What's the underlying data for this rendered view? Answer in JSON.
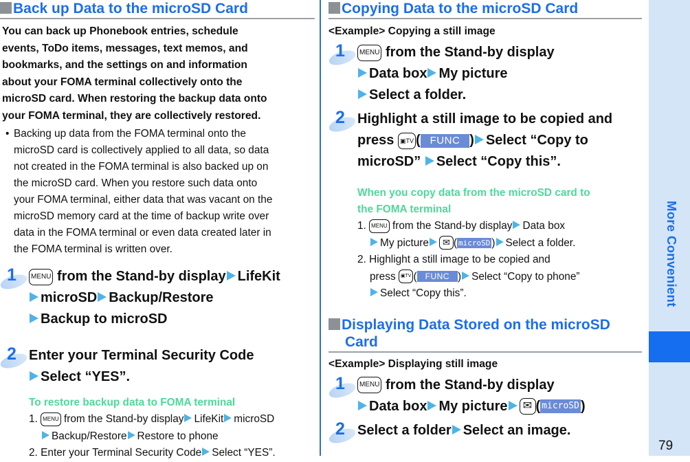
{
  "left": {
    "title": "Back up Data to the microSD Card",
    "intro": "You can back up Phonebook entries, schedule events, ToDo items, messages, text memos, and bookmarks, and the settings on and information about your FOMA terminal collectively onto the microSD card. When restoring the backup data onto your FOMA terminal, they are collectively restored.",
    "intro_lines": [
      "You can back up Phonebook entries, schedule",
      "events, ToDo items, messages, text memos, and",
      "bookmarks, and the settings on and information",
      "about your FOMA terminal collectively onto the",
      "microSD card. When restoring the backup data onto",
      "your FOMA terminal, they are collectively restored."
    ],
    "note_bullet": "•",
    "note_lines": [
      "Backing up data from the FOMA terminal onto the",
      "microSD card is collectively applied to all data, so data",
      "not created in the FOMA terminal is also backed up on",
      "the microSD card. When you restore such data onto",
      "your FOMA terminal, either data that was vacant on the",
      "microSD memory card at the time of backup write over",
      "data in the FOMA terminal or even data created later in",
      "the FOMA terminal is written over."
    ],
    "step1": {
      "number": "1",
      "key": "MENU",
      "text_a": "from the Stand-by display",
      "item_a": "LifeKit",
      "item_b": "microSD",
      "item_c": "Backup/Restore",
      "item_d": "Backup to microSD"
    },
    "step2": {
      "number": "2",
      "text_a": "Enter your Terminal Security Code",
      "text_b": "Select “YES”."
    },
    "restore": {
      "heading": "To restore backup data to FOMA terminal",
      "line1_num": "1.",
      "line1_key": "MENU",
      "line1_a": "from the Stand-by display",
      "line1_b": "LifeKit",
      "line1_c": "microSD",
      "line1_d": "Backup/Restore",
      "line1_e": "Restore to phone",
      "line2_num": "2.",
      "line2_a": "Enter your Terminal Security Code",
      "line2_b": "Select “YES”."
    }
  },
  "right": {
    "copy_title": "Copying Data to the microSD Card",
    "copy_example": "<Example> Copying a still image",
    "copy_step1": {
      "number": "1",
      "key": "MENU",
      "text_a": "from the Stand-by display",
      "item_a": "Data box",
      "item_b": "My picture",
      "item_c": "Select a folder."
    },
    "copy_step2": {
      "number": "2",
      "text_a": "Highlight a still image to be copied and",
      "press": "press",
      "cam_key": "▣TV",
      "func_label": "FUNC",
      "text_b": "Select “Copy to",
      "text_c": "microSD”",
      "text_d": "Select “Copy this”."
    },
    "copy_back": {
      "heading_1": "When you copy data from the microSD card to",
      "heading_2": "the FOMA terminal",
      "l1_num": "1.",
      "l1_key": "MENU",
      "l1_a": "from the Stand-by display",
      "l1_b": "Data box",
      "l1_c": "My picture",
      "l1_mail_key": "✉",
      "l1_msd": "microSD",
      "l1_d": "Select a folder.",
      "l2_num": "2.",
      "l2_a": "Highlight a still image to be copied and",
      "l2_press": "press",
      "l2_cam_key": "▣TV",
      "l2_func": "FUNC",
      "l2_b": "Select “Copy to phone”",
      "l2_c": "Select “Copy this”."
    },
    "display_title_1": "Displaying Data Stored on the microSD",
    "display_title_2": "Card",
    "display_example": "<Example> Displaying still image",
    "display_step1": {
      "number": "1",
      "key": "MENU",
      "text_a": "from the Stand-by display",
      "item_a": "Data box",
      "item_b": "My picture",
      "mail_key": "✉",
      "msd": "microSD"
    },
    "display_step2": {
      "number": "2",
      "text_a": "Select a folder",
      "text_b": "Select an image."
    }
  },
  "side": {
    "chapter": "More Convenient",
    "page_number": "79"
  },
  "colors": {
    "heading_blue": "#1d6ee8",
    "arrow_blue": "#4fb3e8",
    "subheading_green": "#4ed89a",
    "side_bg": "#d3e5f7",
    "side_block": "#156ef0",
    "softkey_bg": "#6a8bd6"
  }
}
